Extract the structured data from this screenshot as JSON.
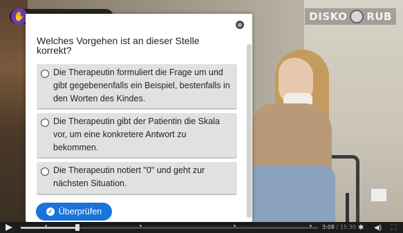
{
  "video": {
    "logo_text_left": "DISKO",
    "logo_text_right": "RUB",
    "time_current": "3:08",
    "time_total": "15:30",
    "progress_fraction": 0.19
  },
  "dialog": {
    "close_glyph": "⊗",
    "question": "Welches Vorgehen ist an dieser Stelle korrekt?",
    "options": [
      {
        "label": "Die Therapeutin formuliert die Frage um und gibt gegebenenfalls ein Beispiel, bestenfalls in den Worten des Kindes."
      },
      {
        "label": "Die Therapeutin gibt der Patientin die Skala vor, um eine konkretere Antwort zu bekommen."
      },
      {
        "label": "Die Therapeutin notiert \"0\" und geht zur nächsten Situation."
      }
    ],
    "check_button": "Überprüfen",
    "accent_color": "#1a73d9"
  },
  "icons": {
    "play": "play-icon",
    "settings": "gear-icon",
    "volume": "volume-icon",
    "check": "check-icon",
    "close": "close-icon"
  }
}
